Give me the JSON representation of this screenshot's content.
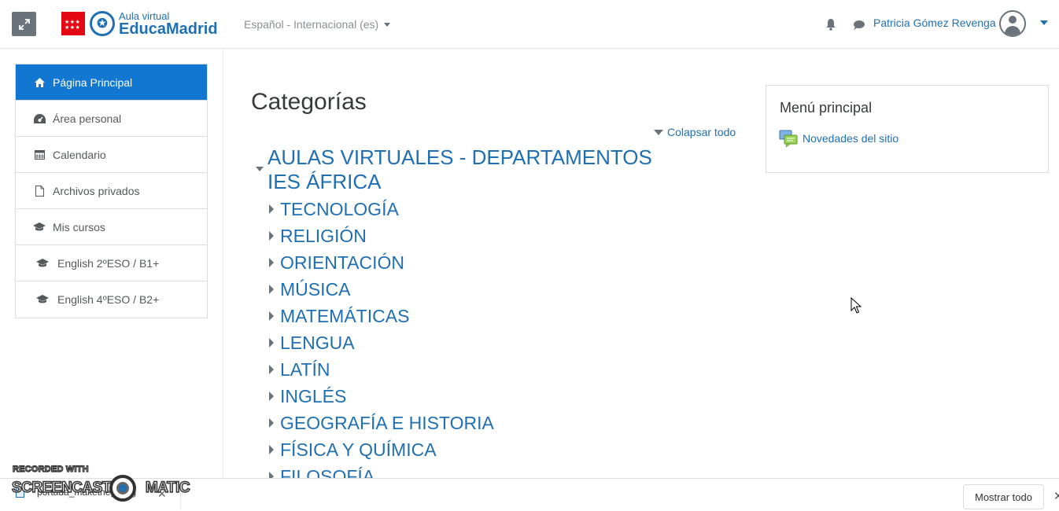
{
  "navbar": {
    "logo_small": "Aula virtual",
    "logo_big": "EducaMadrid",
    "language": "Español - Internacional (es)",
    "user_name": "Patricia Gómez Revenga"
  },
  "sidebar": {
    "items": [
      {
        "label": "Página Principal",
        "icon": "home-icon"
      },
      {
        "label": "Área personal",
        "icon": "dashboard-icon"
      },
      {
        "label": "Calendario",
        "icon": "calendar-icon"
      },
      {
        "label": "Archivos privados",
        "icon": "file-icon"
      },
      {
        "label": "Mis cursos",
        "icon": "graduation-cap-icon"
      },
      {
        "label": "English 2ºESO / B1+",
        "icon": "graduation-cap-icon"
      },
      {
        "label": "English 4ºESO / B2+",
        "icon": "graduation-cap-icon"
      }
    ]
  },
  "main": {
    "title": "Categorías",
    "collapse_all": "Colapsar todo",
    "top_category": "AULAS VIRTUALES - DEPARTAMENTOS IES ÁFRICA",
    "subcategories": [
      "TECNOLOGÍA",
      "RELIGIÓN",
      "ORIENTACIÓN",
      "MÚSICA",
      "MATEMÁTICAS",
      "LENGUA",
      "LATÍN",
      "INGLÉS",
      "GEOGRAFÍA E HISTORIA",
      "FÍSICA Y QUÍMICA",
      "FILOSOFÍA"
    ]
  },
  "block": {
    "title": "Menú principal",
    "link": "Novedades del sitio"
  },
  "download_bar": {
    "file_name": "portada_maketheg...jpg",
    "show_all": "Mostrar todo"
  },
  "watermark": {
    "line1": "RECORDED WITH",
    "line2_left": "SCREENCAST",
    "line2_right": "MATIC"
  }
}
